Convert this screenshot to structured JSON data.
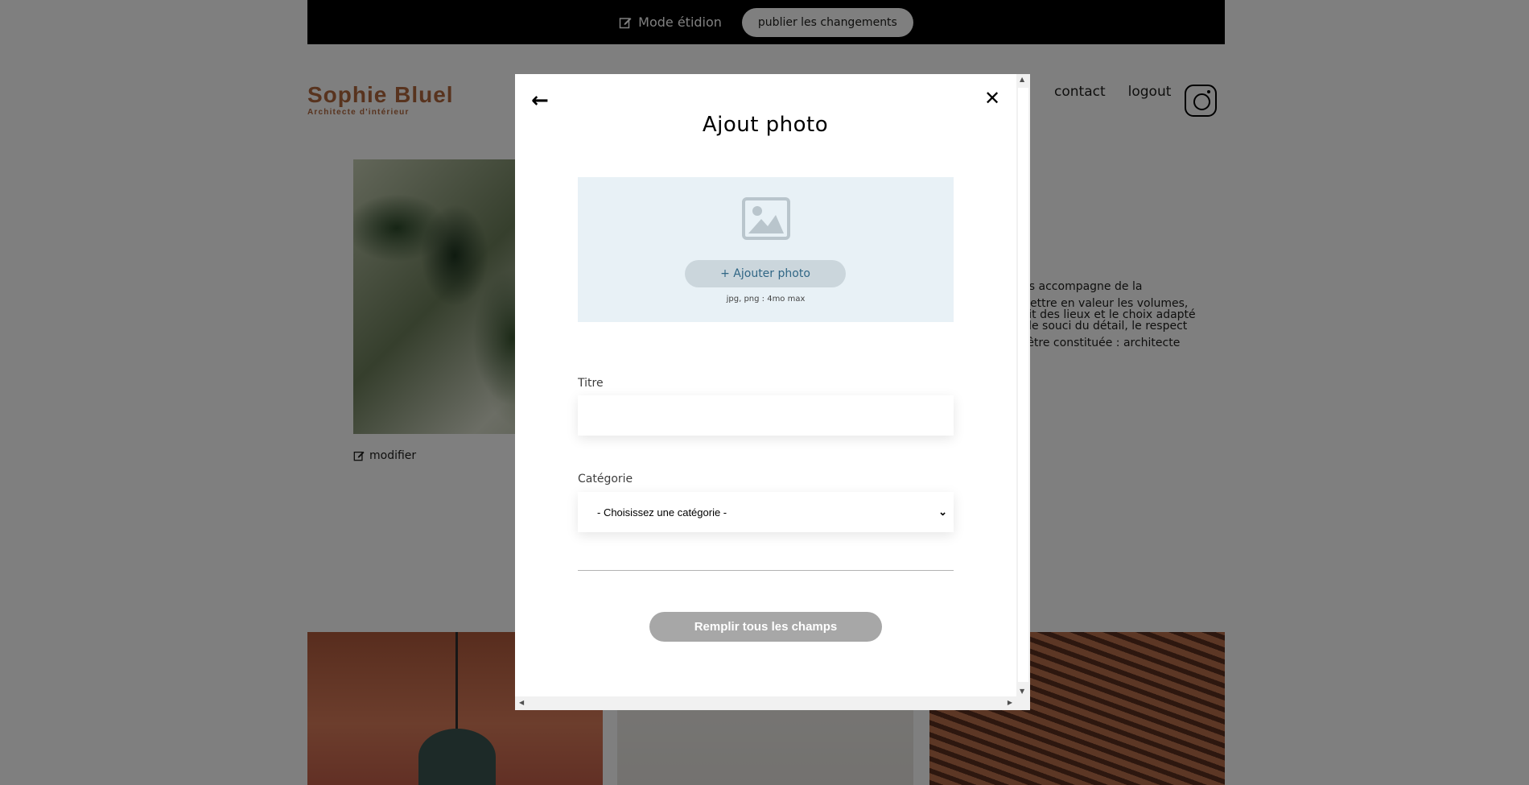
{
  "editbar": {
    "mode_label": "Mode étidion",
    "publish_label": "publier les changements"
  },
  "logo": {
    "brand": "Sophie Bluel",
    "subtitle": "Architecte d'intérieur"
  },
  "nav": {
    "items": [
      "contact",
      "logout"
    ]
  },
  "intro": {
    "modifier_label": "modifier",
    "paragraphs": [
      "e vous accompagne de la",
      "n à mettre en valeur les volumes,\nl'esprit des lieux et le choix adapté\ndans le souci du détail, le respect",
      "peut être constituée : architecte"
    ]
  },
  "modal": {
    "title": "Ajout photo",
    "back_icon": "←",
    "close_icon": "✕",
    "upload": {
      "button_label": "+ Ajouter photo",
      "hint": "jpg, png : 4mo max"
    },
    "title_field": {
      "label": "Titre",
      "value": ""
    },
    "category_field": {
      "label": "Catégorie",
      "selected": "- Choisissez une catégorie -"
    },
    "submit_label": "Remplir tous les champs"
  },
  "colors": {
    "brand": "#b1663c",
    "upload_bg": "#e8f1f6",
    "upload_btn": "#cbd6dc",
    "upload_btn_text": "#306685",
    "disabled_btn": "#a7a7a7"
  }
}
